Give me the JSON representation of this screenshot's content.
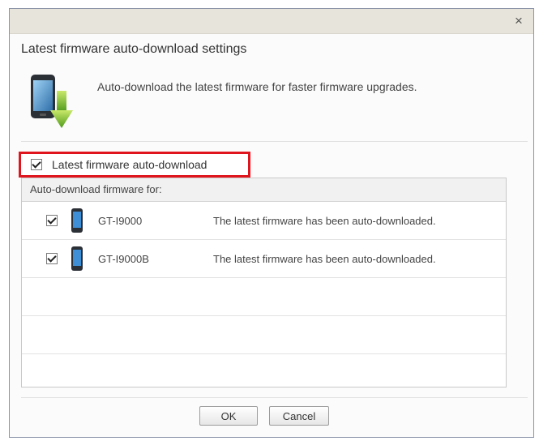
{
  "dialog": {
    "title": "Latest firmware auto-download settings",
    "description": "Auto-download the latest firmware for faster firmware upgrades.",
    "close_glyph": "×",
    "master_checkbox": {
      "label": "Latest firmware auto-download",
      "checked": true
    }
  },
  "list": {
    "header": "Auto-download firmware for:",
    "rows": [
      {
        "checked": true,
        "icon": "phone-icon",
        "model": "GT-I9000",
        "status": "The latest firmware has been auto-downloaded."
      },
      {
        "checked": true,
        "icon": "phone-icon",
        "model": "GT-I9000B",
        "status": "The latest firmware has been auto-downloaded."
      }
    ]
  },
  "buttons": {
    "ok_label": "OK",
    "cancel_label": "Cancel"
  },
  "colors": {
    "highlight": "#e0141c",
    "titlebar": "#e7e5db",
    "border": "#8b93a8"
  },
  "icons": {
    "hero": "phone-download-icon",
    "close": "close-icon"
  }
}
